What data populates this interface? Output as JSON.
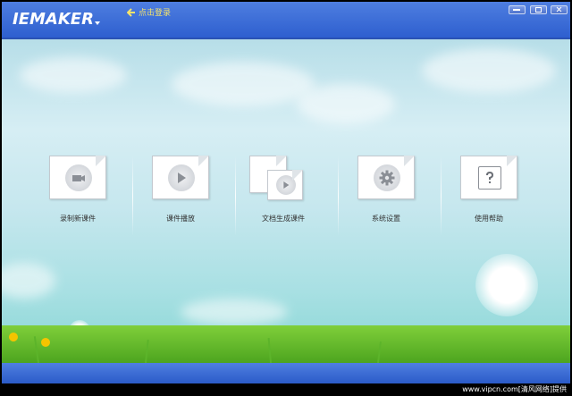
{
  "app": {
    "title": "IEMAKER"
  },
  "header": {
    "login_label": "点击登录"
  },
  "menu": [
    {
      "label": "录制新课件",
      "icon": "record-icon"
    },
    {
      "label": "课件播放",
      "icon": "play-icon"
    },
    {
      "label": "文档生成课件",
      "icon": "document-convert-icon"
    },
    {
      "label": "系统设置",
      "icon": "gear-icon"
    },
    {
      "label": "使用帮助",
      "icon": "help-icon"
    }
  ],
  "watermark": "www.vipcn.com[清风网络]提供",
  "colors": {
    "titlebar": "#3a6ad8",
    "login_text": "#f6e46b",
    "label_text": "#333333"
  }
}
